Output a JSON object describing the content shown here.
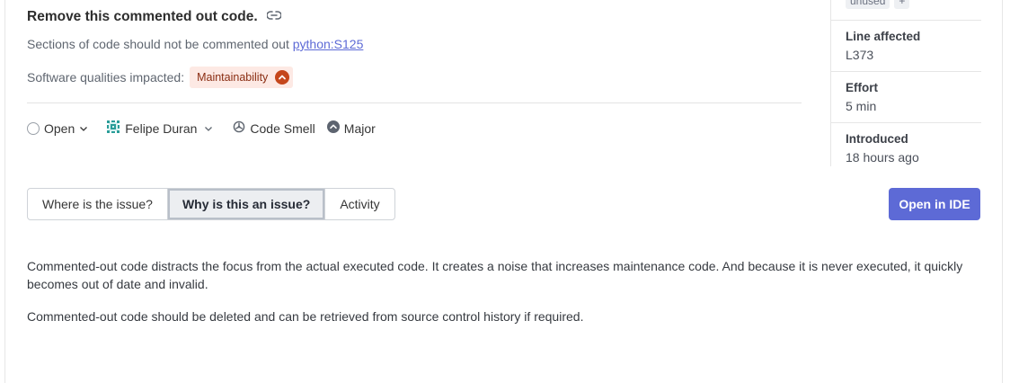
{
  "issue": {
    "title": "Remove this commented out code.",
    "rule_text": "Sections of code should not be commented out",
    "rule_key": "python:S125",
    "qualities_label": "Software qualities impacted:",
    "quality_badge": "Maintainability"
  },
  "meta": {
    "status": "Open",
    "assignee": "Felipe Duran",
    "type": "Code Smell",
    "severity": "Major"
  },
  "tabs": [
    {
      "label": "Where is the issue?",
      "active": false
    },
    {
      "label": "Why is this an issue?",
      "active": true
    },
    {
      "label": "Activity",
      "active": false
    }
  ],
  "description": {
    "p1": "Commented-out code distracts the focus from the actual executed code. It creates a noise that increases maintenance code. And because it is never executed, it quickly becomes out of date and invalid.",
    "p2": "Commented-out code should be deleted and can be retrieved from source control history if required."
  },
  "side": {
    "tags": [
      "unused",
      "+"
    ],
    "line_label": "Line affected",
    "line_value": "L373",
    "effort_label": "Effort",
    "effort_value": "5 min",
    "introduced_label": "Introduced",
    "introduced_value": "18 hours ago"
  },
  "actions": {
    "open_ide": "Open in IDE"
  },
  "colors": {
    "accent": "#5d6ad6",
    "quality_badge_bg": "#fde9e4",
    "severity_high": "#c5461b"
  },
  "icons": [
    "link-icon",
    "severity-up-icon",
    "status-radio-icon",
    "chevron-down-icon",
    "avatar-icon",
    "code-smell-icon",
    "major-severity-icon"
  ]
}
